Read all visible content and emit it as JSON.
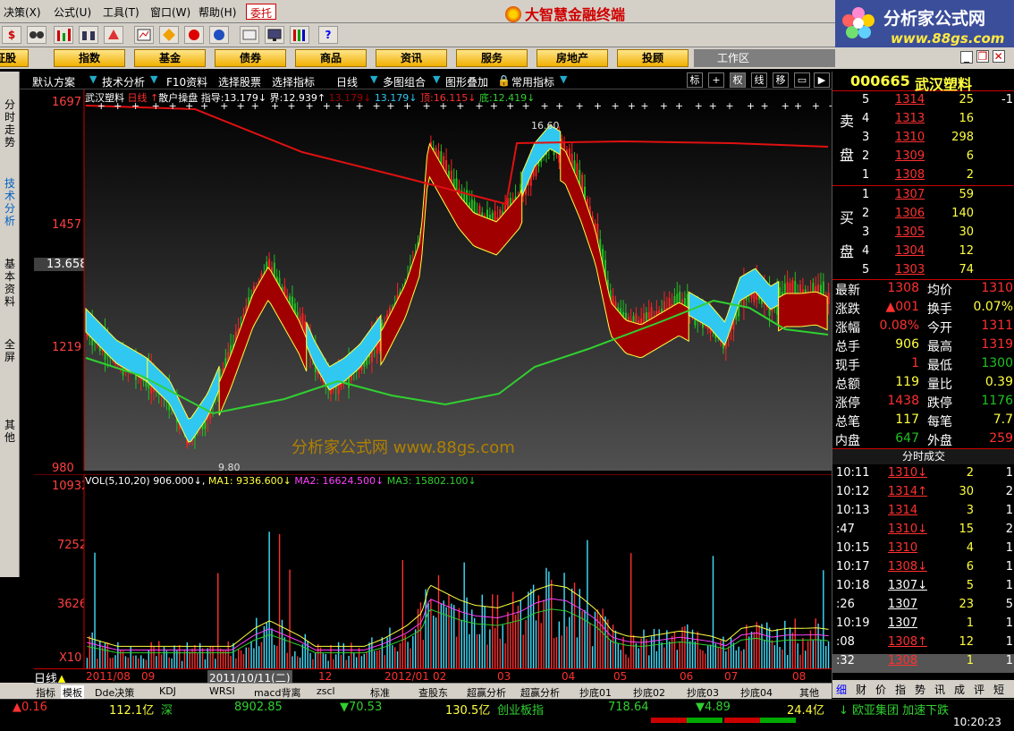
{
  "menu": {
    "items": [
      "决策(X)",
      "公式(U)",
      "工具(T)",
      "窗口(W)",
      "帮助(H)"
    ],
    "weituo": "委托",
    "app_title": "大智慧金融终端"
  },
  "brand": {
    "name": "分析家公式网",
    "url": "www.88gs.com"
  },
  "nav": {
    "first": "证股",
    "buttons": [
      "指数",
      "基金",
      "债券",
      "商品",
      "资讯",
      "服务",
      "房地产",
      "投顾"
    ],
    "workarea": "工作区"
  },
  "tabs": {
    "items": [
      "默认方案",
      "技术分析",
      "F10资料",
      "选择股票",
      "选择指标",
      "日线",
      "多图组合",
      "图形叠加",
      "常用指标"
    ],
    "icons": [
      "标",
      "+",
      "权",
      "线",
      "移"
    ]
  },
  "sidebar": {
    "items": [
      "分时走势",
      "技术分析",
      "基本资料",
      "全屏",
      "其他"
    ]
  },
  "chart": {
    "stock_name": "武汉塑料",
    "period": "日线",
    "formula_name": "散户操盘",
    "info_line": [
      {
        "label": "指导:",
        "value": "13.179↓"
      },
      {
        "label": "界:",
        "value": "12.939↑"
      },
      {
        "label": "",
        "value": "13.179↓"
      },
      {
        "label": "",
        "value": "13.179↓"
      },
      {
        "label": "顶:",
        "value": "16.115↓"
      },
      {
        "label": "底:",
        "value": "12.419↓"
      }
    ],
    "price_axis": [
      "1697",
      "1457",
      "13.658",
      "1219",
      "980"
    ],
    "annotation_high": "16.60",
    "annotation_low": "9.80",
    "watermark": "分析家公式网 www.88gs.com",
    "vol_info": {
      "name": "VOL(5,10,20)",
      "vol": "906.000↓",
      "ma1": "MA1: 9336.600↓",
      "ma2": "MA2: 16624.500↓",
      "ma3": "MA3: 15802.100↓"
    },
    "vol_axis": [
      "10932",
      "7252",
      "3626",
      "X10"
    ],
    "dates": [
      "2011/08",
      "09",
      "2011/10/11(二)",
      "12",
      "2012/01",
      "02",
      "03",
      "04",
      "05",
      "06",
      "07",
      "08"
    ],
    "period_label": "日线",
    "colors": {
      "up": "#ff2020",
      "down": "#20c020",
      "ma_red": "#e01010",
      "ma_green": "#30d030",
      "band_red": "#a00000",
      "band_blue": "#30c8f0",
      "band_line": "#ffff40"
    }
  },
  "indicator_tabs": [
    "指标",
    "模板",
    "Dde决策",
    "KDJ",
    "WRSI",
    "macd背离",
    "zscl",
    "标准",
    "查股东",
    "超赢分析",
    "超赢分析",
    "抄底01",
    "抄底02",
    "抄底03",
    "抄底04",
    "其他"
  ],
  "status": {
    "s1": "▲0.16",
    "s2": "112.1亿",
    "s3": "深",
    "s4": "8902.85",
    "s5": "▼70.53",
    "s6": "130.5亿",
    "s7": "创业板指",
    "s8": "718.64",
    "s9": "▼4.89",
    "s10": "24.4亿",
    "s11": "↓ 欧亚集团 加速下跌",
    "time": "10:20:23"
  },
  "right": {
    "code": "000665",
    "name": "武汉塑料",
    "sell_label": [
      "卖",
      "盘"
    ],
    "buy_label": [
      "买",
      "盘"
    ],
    "sell": [
      {
        "n": "5",
        "p": "1314",
        "v": "25",
        "c": "-1"
      },
      {
        "n": "4",
        "p": "1313",
        "v": "16",
        "c": ""
      },
      {
        "n": "3",
        "p": "1310",
        "v": "298",
        "c": ""
      },
      {
        "n": "2",
        "p": "1309",
        "v": "6",
        "c": ""
      },
      {
        "n": "1",
        "p": "1308",
        "v": "2",
        "c": ""
      }
    ],
    "buy": [
      {
        "n": "1",
        "p": "1307",
        "v": "59",
        "c": ""
      },
      {
        "n": "2",
        "p": "1306",
        "v": "140",
        "c": ""
      },
      {
        "n": "3",
        "p": "1305",
        "v": "30",
        "c": ""
      },
      {
        "n": "4",
        "p": "1304",
        "v": "12",
        "c": ""
      },
      {
        "n": "5",
        "p": "1303",
        "v": "74",
        "c": ""
      }
    ],
    "quotes": [
      {
        "l": "最新",
        "v": "1308",
        "vc": "#ff3030",
        "l2": "均价",
        "v2": "1310",
        "v2c": "#ff3030"
      },
      {
        "l": "涨跌",
        "v": "▲001",
        "vc": "#ff3030",
        "l2": "换手",
        "v2": "0.07%",
        "v2c": "#ffff40"
      },
      {
        "l": "涨幅",
        "v": "0.08%",
        "vc": "#ff3030",
        "l2": "今开",
        "v2": "1311",
        "v2c": "#ff3030"
      },
      {
        "l": "总手",
        "v": "906",
        "vc": "#ffff40",
        "l2": "最高",
        "v2": "1319",
        "v2c": "#ff3030"
      },
      {
        "l": "现手",
        "v": "1",
        "vc": "#ff3030",
        "l2": "最低",
        "v2": "1300",
        "v2c": "#20c020"
      },
      {
        "l": "总额",
        "v": "119",
        "vc": "#ffff40",
        "l2": "量比",
        "v2": "0.39",
        "v2c": "#ffff40"
      },
      {
        "l": "涨停",
        "v": "1438",
        "vc": "#ff3030",
        "l2": "跌停",
        "v2": "1176",
        "v2c": "#20c020"
      },
      {
        "l": "总笔",
        "v": "117",
        "vc": "#ffff40",
        "l2": "每笔",
        "v2": "7.7",
        "v2c": "#ffff40"
      },
      {
        "l": "内盘",
        "v": "647",
        "vc": "#20c020",
        "l2": "外盘",
        "v2": "259",
        "v2c": "#ff3030"
      }
    ],
    "trades_title": "分时成交",
    "trades": [
      {
        "t": "10:11",
        "p": "1310↓",
        "pc": "#ff3030",
        "v": "2",
        "c": "1"
      },
      {
        "t": "10:12",
        "p": "1314↑",
        "pc": "#ff3030",
        "v": "30",
        "c": "2"
      },
      {
        "t": "10:13",
        "p": "1314",
        "pc": "#ff3030",
        "v": "3",
        "c": "1"
      },
      {
        "t": ":47",
        "p": "1310↓",
        "pc": "#ff3030",
        "v": "15",
        "c": "2"
      },
      {
        "t": "10:15",
        "p": "1310",
        "pc": "#ff3030",
        "v": "4",
        "c": "1"
      },
      {
        "t": "10:17",
        "p": "1308↓",
        "pc": "#ff3030",
        "v": "6",
        "c": "1"
      },
      {
        "t": "10:18",
        "p": "1307↓",
        "pc": "#ffffff",
        "v": "5",
        "c": "1"
      },
      {
        "t": ":26",
        "p": "1307",
        "pc": "#ffffff",
        "v": "23",
        "c": "5"
      },
      {
        "t": "10:19",
        "p": "1307",
        "pc": "#ffffff",
        "v": "1",
        "c": "1"
      },
      {
        "t": ":08",
        "p": "1308↑",
        "pc": "#ff3030",
        "v": "12",
        "c": "1"
      },
      {
        "t": ":32",
        "p": "1308",
        "pc": "#ff3030",
        "v": "1",
        "c": "1"
      }
    ],
    "bottom_tabs": [
      "细",
      "财",
      "价",
      "指",
      "势",
      "讯",
      "成",
      "评",
      "短"
    ]
  }
}
